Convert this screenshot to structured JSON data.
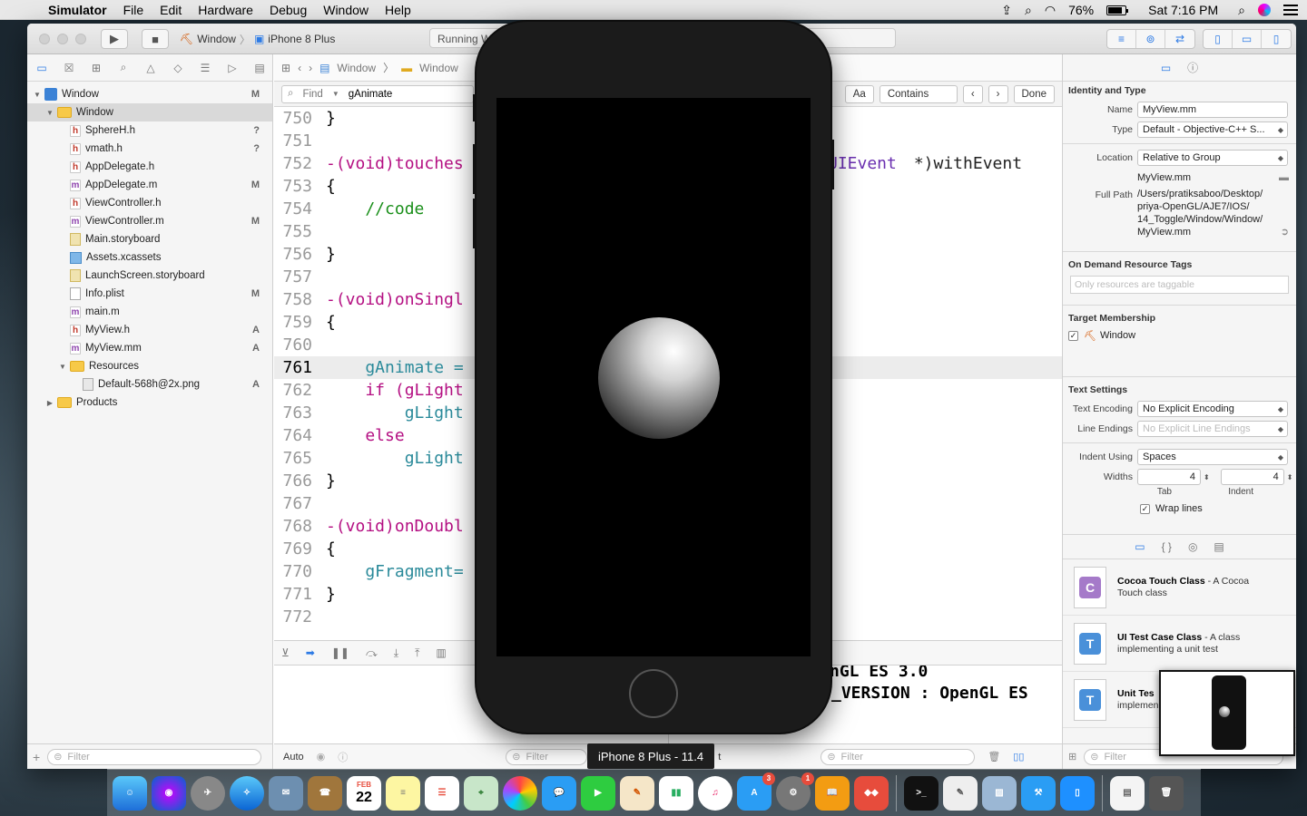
{
  "menubar": {
    "app_name": "Simulator",
    "items": [
      "File",
      "Edit",
      "Hardware",
      "Debug",
      "Window",
      "Help"
    ],
    "battery": "76%",
    "clock": "Sat 7:16 PM"
  },
  "toolbar": {
    "scheme_name": "Window",
    "device_name": "iPhone 8 Plus",
    "activity": "Running W"
  },
  "navigator": {
    "items": [
      {
        "label": "Window",
        "status": "M"
      },
      {
        "label": "Window",
        "status": ""
      },
      {
        "label": "SphereH.h",
        "status": "?"
      },
      {
        "label": "vmath.h",
        "status": "?"
      },
      {
        "label": "AppDelegate.h",
        "status": ""
      },
      {
        "label": "AppDelegate.m",
        "status": "M"
      },
      {
        "label": "ViewController.h",
        "status": ""
      },
      {
        "label": "ViewController.m",
        "status": "M"
      },
      {
        "label": "Main.storyboard",
        "status": ""
      },
      {
        "label": "Assets.xcassets",
        "status": ""
      },
      {
        "label": "LaunchScreen.storyboard",
        "status": ""
      },
      {
        "label": "Info.plist",
        "status": "M"
      },
      {
        "label": "main.m",
        "status": ""
      },
      {
        "label": "MyView.h",
        "status": "A"
      },
      {
        "label": "MyView.mm",
        "status": "A"
      },
      {
        "label": "Resources",
        "status": ""
      },
      {
        "label": "Default-568h@2x.png",
        "status": "A"
      },
      {
        "label": "Products",
        "status": ""
      }
    ],
    "filter_placeholder": "Filter"
  },
  "editor": {
    "breadcrumb": [
      "Window",
      "Window"
    ],
    "find_mode": "Find",
    "find_query": "gAnimate",
    "match_case": "Aa",
    "match_mode": "Contains",
    "done_label": "Done",
    "lines": [
      {
        "n": "750",
        "text": "}"
      },
      {
        "n": "751",
        "text": ""
      },
      {
        "n": "752",
        "text": "-(void)touches"
      },
      {
        "n": "753",
        "text": "{"
      },
      {
        "n": "754",
        "text": "    //code"
      },
      {
        "n": "755",
        "text": ""
      },
      {
        "n": "756",
        "text": "}"
      },
      {
        "n": "757",
        "text": ""
      },
      {
        "n": "758",
        "text": "-(void)onSingl"
      },
      {
        "n": "759",
        "text": "{"
      },
      {
        "n": "760",
        "text": ""
      },
      {
        "n": "761",
        "text": "    gAnimate ="
      },
      {
        "n": "762",
        "text": "    if (gLight"
      },
      {
        "n": "763",
        "text": "        gLight"
      },
      {
        "n": "764",
        "text": "    else"
      },
      {
        "n": "765",
        "text": "        gLight"
      },
      {
        "n": "766",
        "text": "}"
      },
      {
        "n": "767",
        "text": ""
      },
      {
        "n": "768",
        "text": "-(void)onDoubl"
      },
      {
        "n": "769",
        "text": "{"
      },
      {
        "n": "770",
        "text": "    gFragment="
      },
      {
        "n": "771",
        "text": "}"
      },
      {
        "n": "772",
        "text": ""
      }
    ],
    "line752_tail_type": "UIEvent",
    "line752_tail_rest": " *)withEvent",
    "console_line1": "nGL ES 3.0",
    "console_line2": "_VERSION : OpenGL ES",
    "bottom_auto": "Auto",
    "bottom_filter": "Filter",
    "console_filter": "Filter",
    "console_scope": "t"
  },
  "inspector": {
    "identity_title": "Identity and Type",
    "name_label": "Name",
    "name_value": "MyView.mm",
    "type_label": "Type",
    "type_value": "Default - Objective-C++ S...",
    "location_label": "Location",
    "location_value": "Relative to Group",
    "location_file": "MyView.mm",
    "fullpath_label": "Full Path",
    "fullpath_lines": [
      "/Users/pratiksaboo/Desktop/",
      "priya-OpenGL/AJE7/IOS/",
      "14_Toggle/Window/Window/",
      "MyView.mm"
    ],
    "ondemand_title": "On Demand Resource Tags",
    "ondemand_placeholder": "Only resources are taggable",
    "target_title": "Target Membership",
    "target_name": "Window",
    "text_settings_title": "Text Settings",
    "encoding_label": "Text Encoding",
    "encoding_value": "No Explicit Encoding",
    "line_endings_label": "Line Endings",
    "line_endings_value": "No Explicit Line Endings",
    "indent_label": "Indent Using",
    "indent_value": "Spaces",
    "widths_label": "Widths",
    "tab_value": "4",
    "indent_width_value": "4",
    "tab_caption": "Tab",
    "indent_caption": "Indent",
    "wrap_label": "Wrap lines",
    "library": [
      {
        "icon": "C",
        "color": "#a57ac9",
        "title": "Cocoa Touch Class",
        "desc_line1": " - A Cocoa",
        "desc_line2": "Touch class"
      },
      {
        "icon": "T",
        "color": "#4a90d9",
        "title": "UI Test Case Class",
        "desc_line1": " - A class",
        "desc_line2": "implementing a unit test"
      },
      {
        "icon": "T",
        "color": "#4a90d9",
        "title": "Unit Tes",
        "desc_line1": "",
        "desc_line2": "implemen"
      }
    ],
    "library_filter": "Filter"
  },
  "simulator": {
    "device_label": "iPhone 8 Plus - 11.4"
  },
  "dock": {
    "calendar_month": "FEB",
    "calendar_day": "22",
    "appstore_badge": "3",
    "prefs_badge": "1"
  }
}
